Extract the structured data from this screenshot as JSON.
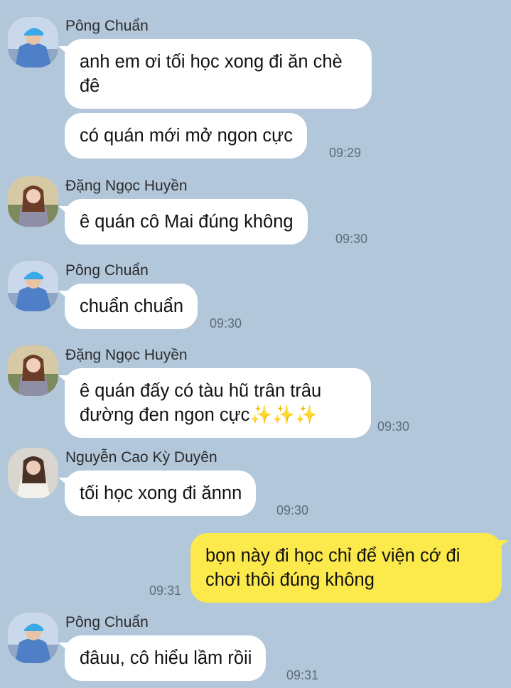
{
  "messages": {
    "m1": {
      "sender": "Pông Chuẩn",
      "text": "anh em ơi tối học xong đi ăn chè đê"
    },
    "m2": {
      "text": "có quán mới mở ngon cực",
      "time": "09:29"
    },
    "m3": {
      "sender": "Đặng Ngọc Huyền",
      "text": "ê quán cô Mai đúng không",
      "time": "09:30"
    },
    "m4": {
      "sender": "Pông Chuẩn",
      "text": "chuẩn chuẩn",
      "time": "09:30"
    },
    "m5": {
      "sender": "Đặng Ngọc Huyền",
      "text_line1": "ê quán đấy có tàu hũ trân trâu",
      "text_line2": "đường đen ngon cực",
      "emoji": "✨✨✨",
      "time": "09:30"
    },
    "m6": {
      "sender": "Nguyễn Cao Kỳ Duyên",
      "text": "tối học xong đi ănnn",
      "time": "09:30"
    },
    "m7": {
      "text": "bọn này đi học chỉ để viện cớ đi chơi thôi đúng không",
      "time": "09:31"
    },
    "m8": {
      "sender": "Pông Chuẩn",
      "text": "đâuu, cô hiểu lầm rồii",
      "time": "09:31"
    }
  },
  "colors": {
    "background": "#b2c7da",
    "bubble_other": "#ffffff",
    "bubble_mine": "#fce94b"
  }
}
